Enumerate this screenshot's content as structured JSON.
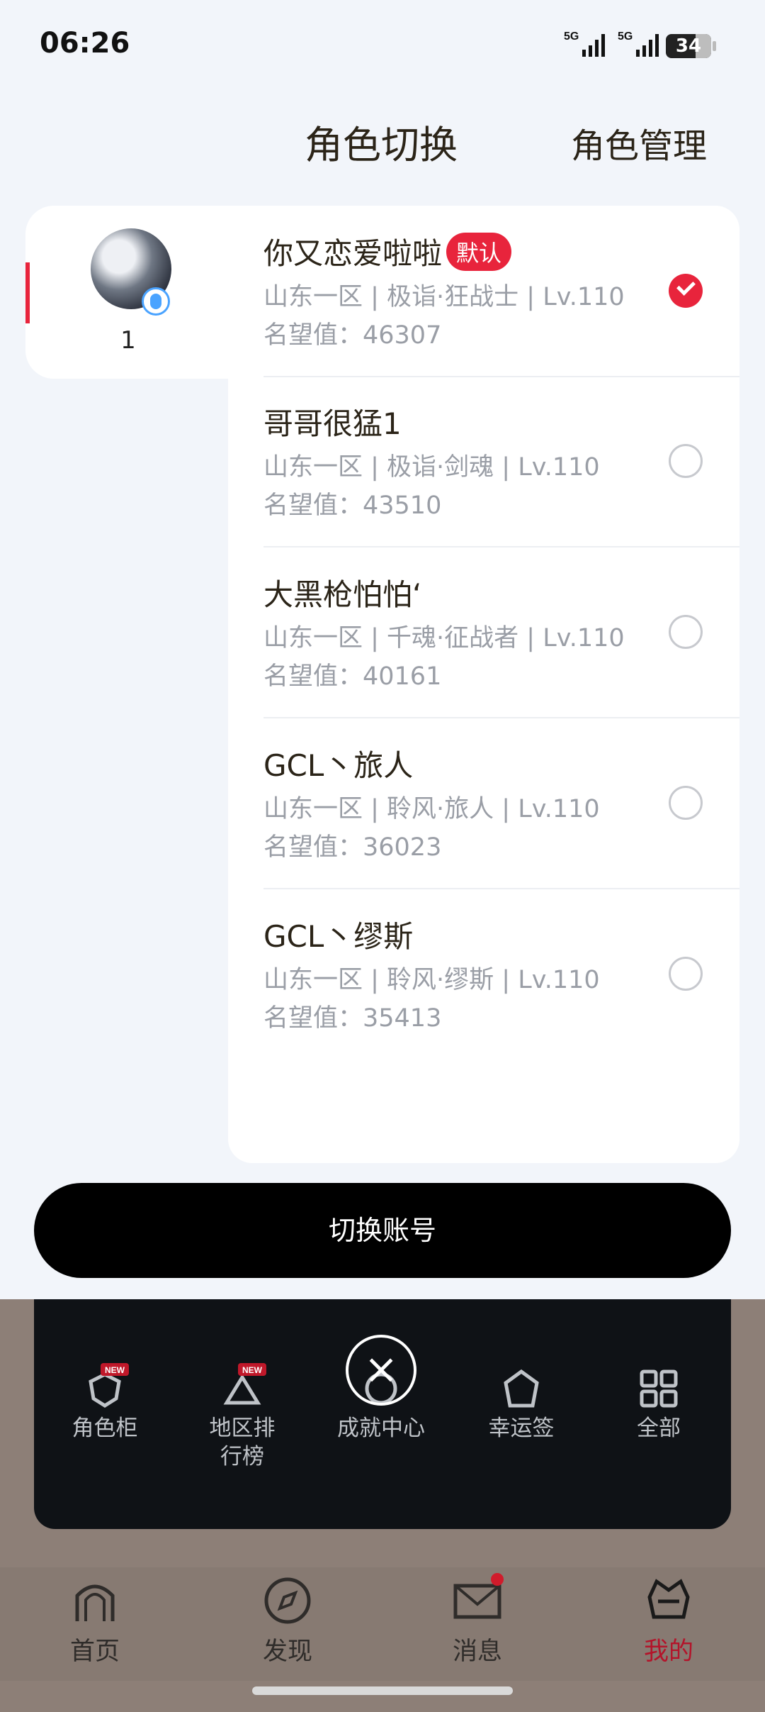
{
  "status_bar": {
    "time": "06:26",
    "network1": "5G",
    "network2": "5G",
    "battery": "34"
  },
  "header": {
    "title": "角色切换",
    "manage": "角色管理"
  },
  "account": {
    "name": "1"
  },
  "roles": [
    {
      "name": "你又恋爱啦啦",
      "tag": "默认",
      "server": "山东一区 | 极诣·狂战士 | Lv.110",
      "fame": "名望值：46307",
      "selected": true
    },
    {
      "name": "哥哥很猛1",
      "tag": "",
      "server": "山东一区 | 极诣·剑魂 | Lv.110",
      "fame": "名望值：43510",
      "selected": false
    },
    {
      "name": "大黑枪怕怕‘",
      "tag": "",
      "server": "山东一区 | 千魂·征战者 | Lv.110",
      "fame": "名望值：40161",
      "selected": false
    },
    {
      "name": "GCL丶旅人",
      "tag": "",
      "server": "山东一区 | 聆风·旅人 | Lv.110",
      "fame": "名望值：36023",
      "selected": false
    },
    {
      "name": "GCL丶缪斯",
      "tag": "",
      "server": "山东一区 | 聆风·缪斯 | Lv.110",
      "fame": "名望值：35413",
      "selected": false
    }
  ],
  "switch_button": "切换账号",
  "quick_menu": [
    {
      "label": "角色柜",
      "icon": "character-cabinet-icon"
    },
    {
      "label": "地区排行榜",
      "icon": "ranking-icon"
    },
    {
      "label": "成就中心",
      "icon": "achievement-icon"
    },
    {
      "label": "幸运签",
      "icon": "lucky-sign-icon"
    },
    {
      "label": "全部",
      "icon": "grid-icon"
    }
  ],
  "new_badge": "NEW",
  "tabs": [
    {
      "label": "首页",
      "icon": "home-icon"
    },
    {
      "label": "发现",
      "icon": "compass-icon"
    },
    {
      "label": "消息",
      "icon": "mail-icon"
    },
    {
      "label": "我的",
      "icon": "profile-icon",
      "active": true
    }
  ]
}
